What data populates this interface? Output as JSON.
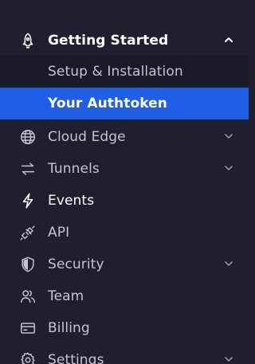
{
  "sidebar": {
    "accent_color": "#1f5fe6",
    "background_color": "#1f1f30",
    "items": [
      {
        "label": "Getting Started",
        "icon": "rocket-icon",
        "expanded": true,
        "has_chevron": true
      },
      {
        "label": "Setup & Installation",
        "sub": true
      },
      {
        "label": "Your Authtoken",
        "sub": true,
        "active": true
      },
      {
        "label": "Cloud Edge",
        "icon": "globe-icon",
        "has_chevron": true
      },
      {
        "label": "Tunnels",
        "icon": "arrows-swap-icon",
        "has_chevron": true
      },
      {
        "label": "Events",
        "icon": "lightning-icon"
      },
      {
        "label": "API",
        "icon": "plug-icon"
      },
      {
        "label": "Security",
        "icon": "shield-icon",
        "has_chevron": true
      },
      {
        "label": "Team",
        "icon": "users-icon"
      },
      {
        "label": "Billing",
        "icon": "credit-card-icon"
      },
      {
        "label": "Settings",
        "icon": "gear-icon",
        "has_chevron": true
      }
    ]
  }
}
